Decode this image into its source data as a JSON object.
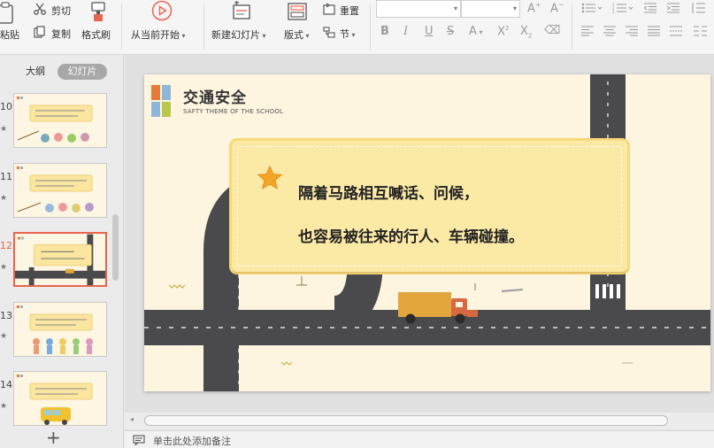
{
  "ribbon": {
    "paste": "粘贴",
    "cut": "剪切",
    "copy": "复制",
    "format_painter": "格式刷",
    "from_current": "从当前开始",
    "new_slide": "新建幻灯片",
    "layout": "版式",
    "reset": "重置",
    "section": "节"
  },
  "panel": {
    "tab_outline": "大纲",
    "tab_slides": "幻灯片",
    "slides": [
      {
        "num": "10"
      },
      {
        "num": "11"
      },
      {
        "num": "12"
      },
      {
        "num": "13"
      },
      {
        "num": "14"
      }
    ],
    "add": "+"
  },
  "slide": {
    "title": "交通安全",
    "subtitle": "SAFTY THEME OF THE SCHOOL",
    "line1": "隔着马路相互喊话、问候，",
    "line2": "也容易被往来的行人、车辆碰撞。"
  },
  "notes": {
    "placeholder": "单击此处添加备注"
  },
  "colors": {
    "accent": "#e8644e",
    "road": "#4a4a4d",
    "card": "#fbe9a6",
    "truck": "#e3a63c"
  }
}
